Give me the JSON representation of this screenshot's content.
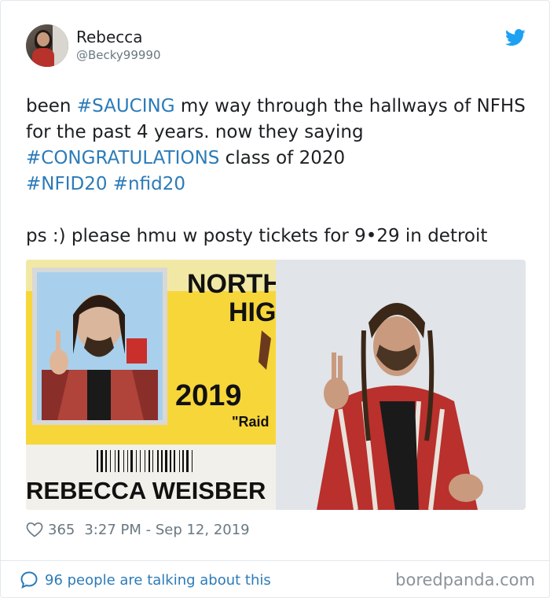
{
  "user": {
    "display_name": "Rebecca",
    "handle": "@Becky99990"
  },
  "tweet": {
    "segments": [
      {
        "text": "been ",
        "tag": false
      },
      {
        "text": "#SAUCING",
        "tag": true
      },
      {
        "text": " my way through the hallways of NFHS for the past 4 years. now they saying ",
        "tag": false
      },
      {
        "text": "#CONGRATULATIONS",
        "tag": true
      },
      {
        "text": " class of 2020\n",
        "tag": false
      },
      {
        "text": "#NFID20",
        "tag": true
      },
      {
        "text": " ",
        "tag": false
      },
      {
        "text": "#nfid20",
        "tag": true
      },
      {
        "text": "\n\nps :) please hmu w posty tickets for 9•29 in detroit",
        "tag": false
      }
    ]
  },
  "media": {
    "id_card": {
      "school_line1": "NORTH F",
      "school_line2": "HIGH",
      "year": "2019",
      "motto": "\"Raid",
      "student_name": "REBECCA WEISBER"
    }
  },
  "meta": {
    "likes": "365",
    "timestamp": "3:27 PM - Sep 12, 2019"
  },
  "footer": {
    "talking": "96 people are talking about this",
    "watermark": "boredpanda.com"
  },
  "colors": {
    "link": "#2b7bb9",
    "muted": "#697882",
    "twitter_blue": "#1da1f2",
    "id_yellow": "#f7d63a"
  },
  "icons": [
    "twitter-bird-icon",
    "heart-icon",
    "speech-bubble-icon"
  ]
}
